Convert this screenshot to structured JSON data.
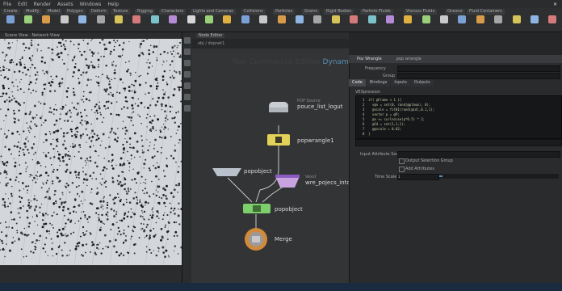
{
  "menubar": {
    "items": [
      "File",
      "Edit",
      "Render",
      "Assets",
      "Windows",
      "Help"
    ],
    "close": "✕"
  },
  "shelf": {
    "tabs": [
      "Create",
      "Modify",
      "Model",
      "Polygon",
      "Deform",
      "Texture",
      "Rigging",
      "Characters",
      "Lights and Cameras",
      "Collisions",
      "Particles",
      "Grains",
      "Rigid Bodies",
      "Particle Fluids",
      "Viscous Fluids",
      "Oceans",
      "Fluid Containers"
    ],
    "tool_colors": [
      "#7aa0d6",
      "#9ad07a",
      "#d89b4a",
      "#c9c9c9",
      "#8fb6e2",
      "#a6a6a6",
      "#d6c35a",
      "#d47a7a",
      "#7ac3c9",
      "#b58ad6",
      "#d7d7d7",
      "#9ad07a",
      "#e0b040",
      "#7aa0d6",
      "#c9c9c9",
      "#d89b4a",
      "#8fb6e2",
      "#a6a6a6",
      "#d6c35a",
      "#d47a7a",
      "#7ac3c9",
      "#b58ad6",
      "#e0b040",
      "#9ad07a",
      "#c9c9c9",
      "#7aa0d6",
      "#d89b4a",
      "#a6a6a6",
      "#d6c35a",
      "#8fb6e2",
      "#d47a7a"
    ]
  },
  "viewport": {
    "header": "Scene View · Network View"
  },
  "network": {
    "header_tab": "Node Editor",
    "path": "obj / dopnet1",
    "title_faded": "Non Commercial Edition",
    "title_dynamics": "Dynamics",
    "nodes": [
      {
        "label": "POP Source",
        "sub": "pouce_list_logut",
        "color": "#c9cdd2"
      },
      {
        "label": "popwrangle1",
        "sub": "",
        "color": "#e2d25a"
      },
      {
        "label": "popobject",
        "sub": "",
        "color": "#b9c2cc"
      },
      {
        "label": "Vexst",
        "sub": "wre_pojecs_into_",
        "color": "#c8a3e0"
      },
      {
        "label": "popobject",
        "sub": "",
        "color": "#7ccf6a"
      },
      {
        "label": "Merge",
        "sub": "",
        "color": "#d08a3a"
      }
    ]
  },
  "params": {
    "node_name": "Poz Wrangle",
    "node_type": "pop wrangle",
    "rows": [
      "Frequency",
      "Group"
    ],
    "tabs": [
      "Code",
      "Bindings",
      "Inputs",
      "Outputs"
    ],
    "vex_label": "VEXpression",
    "code_lines": [
      "1  if( @Frame < 1 ){",
      "2    v@v = set(0, rand(@ptnum), 0);",
      "3    @scale = fit01(rand(@id),0.1,1);",
      "4    vector p = @P;",
      "5    @v += curlnoise(p*0.5) * 2;",
      "6    @Cd = set(1,1,1);",
      "7    @pscale = 0.02;",
      "8  }"
    ],
    "lower_rows": [
      "Input Attribute Sources",
      "Output Selection Group",
      "Add Attributes",
      "Time Scale"
    ],
    "time_scale": "1"
  }
}
